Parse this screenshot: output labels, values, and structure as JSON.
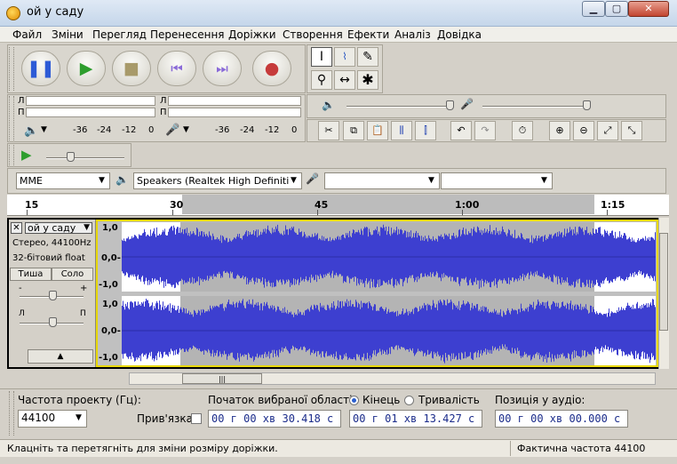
{
  "window": {
    "title": "ой у саду"
  },
  "menu": [
    "Файл",
    "Зміни",
    "Перегляд",
    "Перенесення",
    "Доріжки",
    "Створення",
    "Ефекти",
    "Аналіз",
    "Довідка"
  ],
  "transport": {
    "pause_icon": "pause-icon",
    "play_icon": "play-icon",
    "stop_icon": "stop-icon",
    "skip_start_icon": "skip-start-icon",
    "skip_end_icon": "skip-end-icon",
    "record_icon": "record-icon"
  },
  "meters": {
    "left_label": "Л",
    "right_label": "П",
    "ticks": [
      "-36",
      "-24",
      "-12",
      "0"
    ],
    "input_ticks": [
      "-36",
      "-24",
      "-12",
      "0"
    ]
  },
  "devices": {
    "host": "MME",
    "output": "Speakers (Realtek High Definiti",
    "input": "",
    "channels": ""
  },
  "ruler": {
    "labels": [
      "15",
      "30",
      "45",
      "1:00",
      "1:15"
    ]
  },
  "track": {
    "name": "ой у саду",
    "info1": "Стерео, 44100Hz",
    "info2": "32-бітовий float",
    "mute": "Тиша",
    "solo": "Соло",
    "gain_minus": "-",
    "gain_plus": "+",
    "pan_left": "Л",
    "pan_right": "П",
    "scale": [
      "1,0",
      "0,0-",
      "-1,0",
      "1,0",
      "0,0-",
      "-1,0"
    ]
  },
  "selection_bar": {
    "rate_label": "Частота проекту (Гц):",
    "rate_value": "44100",
    "snap_label": "Прив'язка",
    "start_label": "Початок вибраної області:",
    "end_option": "Кінець",
    "length_option": "Тривалість",
    "end_selected": true,
    "start_value": "00 г 00 хв 30.418 с",
    "end_value": "00 г 01 хв 13.427 с",
    "position_label": "Позиція у аудіо:",
    "position_value": "00 г 00 хв 00.000 с"
  },
  "status": {
    "hint": "Клацніть та перетягніть для зміни розміру доріжки.",
    "rate": "Фактична частота 44100"
  },
  "colors": {
    "wave": "#3d3fd0",
    "selection": "#b4b4b4",
    "track_border": "#e8d800"
  }
}
